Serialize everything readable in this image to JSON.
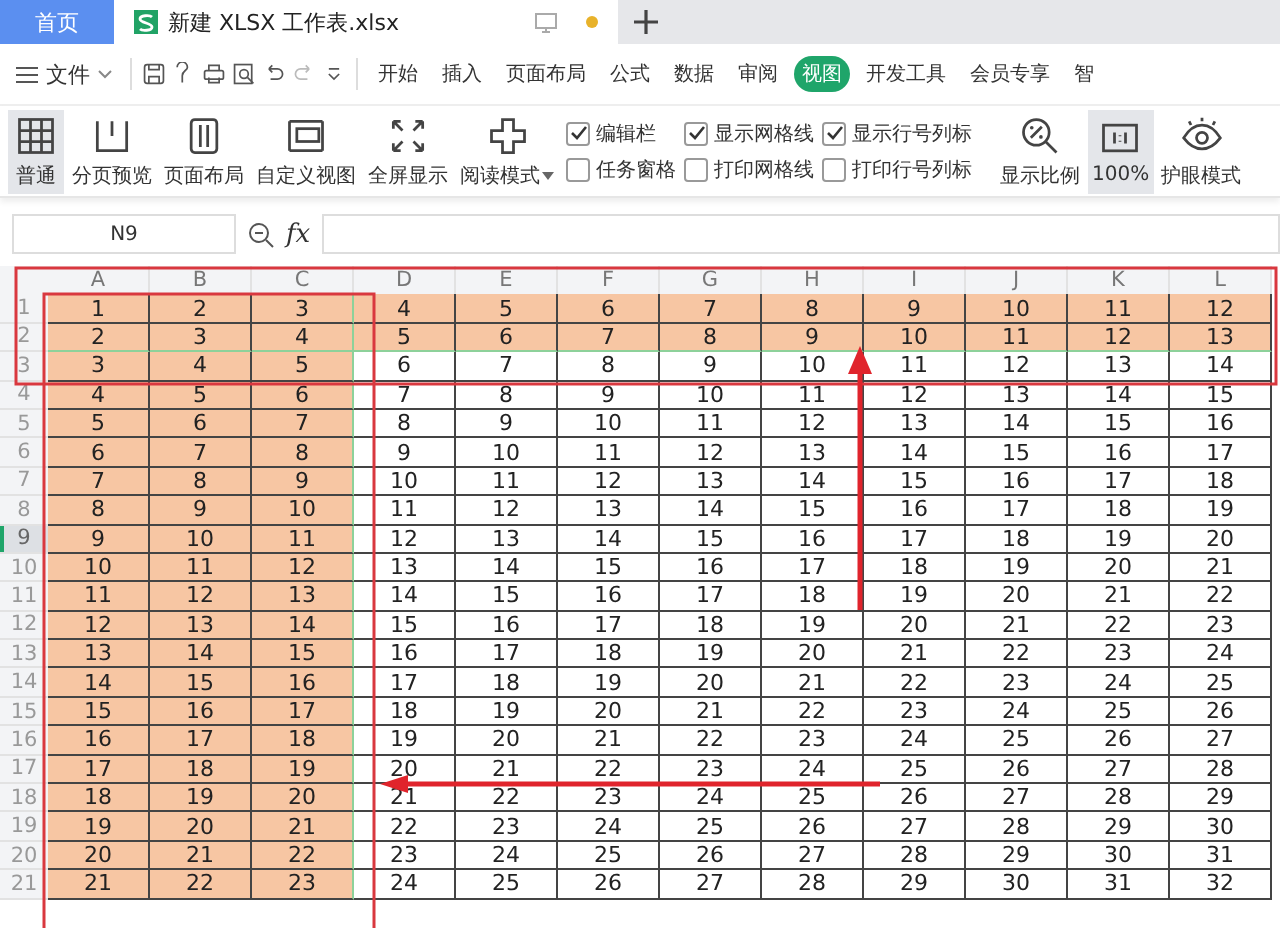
{
  "window_tabs": [
    {
      "label": "首页",
      "kind": "home",
      "selected": false
    },
    {
      "label": "新建 XLSX 工作表.xlsx",
      "kind": "doc",
      "selected": true
    }
  ],
  "quick_toolbar": {
    "file_menu": "文件"
  },
  "ribbon_tabs": [
    {
      "label": "开始",
      "selected": false
    },
    {
      "label": "插入",
      "selected": false
    },
    {
      "label": "页面布局",
      "selected": false
    },
    {
      "label": "公式",
      "selected": false
    },
    {
      "label": "数据",
      "selected": false
    },
    {
      "label": "审阅",
      "selected": false
    },
    {
      "label": "视图",
      "selected": true
    },
    {
      "label": "开发工具",
      "selected": false
    },
    {
      "label": "会员专享",
      "selected": false
    },
    {
      "label": "智",
      "selected": false
    }
  ],
  "view_buttons": [
    {
      "label": "普通",
      "selected": true
    },
    {
      "label": "分页预览",
      "selected": false
    },
    {
      "label": "页面布局",
      "selected": false
    },
    {
      "label": "自定义视图",
      "selected": false
    },
    {
      "label": "全屏显示",
      "selected": false
    },
    {
      "label": "阅读模式",
      "selected": false,
      "dropdown": true
    }
  ],
  "checkbox_columns": [
    [
      {
        "label": "编辑栏",
        "checked": true
      },
      {
        "label": "任务窗格",
        "checked": false
      }
    ],
    [
      {
        "label": "显示网格线",
        "checked": true
      },
      {
        "label": "打印网格线",
        "checked": false
      }
    ],
    [
      {
        "label": "显示行号列标",
        "checked": true
      },
      {
        "label": "打印行号列标",
        "checked": false
      }
    ]
  ],
  "zoom_buttons": [
    {
      "label": "显示比例",
      "selected": false
    },
    {
      "label": "100%",
      "selected": true
    },
    {
      "label": "护眼模式",
      "selected": false
    }
  ],
  "formula_bar": {
    "cell_ref": "N9",
    "fx": "fx"
  },
  "sheet": {
    "columns": [
      {
        "label": "A",
        "highlighted": true,
        "freeze_border": false
      },
      {
        "label": "B",
        "highlighted": true,
        "freeze_border": false
      },
      {
        "label": "C",
        "highlighted": true,
        "freeze_border": true
      },
      {
        "label": "D",
        "highlighted": false,
        "freeze_border": false
      },
      {
        "label": "E",
        "highlighted": false,
        "freeze_border": false
      },
      {
        "label": "F",
        "highlighted": false,
        "freeze_border": false
      },
      {
        "label": "G",
        "highlighted": false,
        "freeze_border": false
      },
      {
        "label": "H",
        "highlighted": false,
        "freeze_border": false
      },
      {
        "label": "I",
        "highlighted": false,
        "freeze_border": false
      },
      {
        "label": "J",
        "highlighted": false,
        "freeze_border": false
      },
      {
        "label": "K",
        "highlighted": false,
        "freeze_border": false
      },
      {
        "label": "L",
        "highlighted": false,
        "freeze_border": false
      }
    ],
    "rows": [
      {
        "number": "1",
        "highlighted": true,
        "frozen": false,
        "selected": false,
        "cells": [
          "1",
          "2",
          "3",
          "4",
          "5",
          "6",
          "7",
          "8",
          "9",
          "10",
          "11",
          "12"
        ]
      },
      {
        "number": "2",
        "highlighted": true,
        "frozen": true,
        "selected": false,
        "cells": [
          "2",
          "3",
          "4",
          "5",
          "6",
          "7",
          "8",
          "9",
          "10",
          "11",
          "12",
          "13"
        ]
      },
      {
        "number": "3",
        "highlighted": false,
        "frozen": false,
        "selected": false,
        "cells": [
          "3",
          "4",
          "5",
          "6",
          "7",
          "8",
          "9",
          "10",
          "11",
          "12",
          "13",
          "14"
        ]
      },
      {
        "number": "4",
        "highlighted": false,
        "frozen": false,
        "selected": false,
        "cells": [
          "4",
          "5",
          "6",
          "7",
          "8",
          "9",
          "10",
          "11",
          "12",
          "13",
          "14",
          "15"
        ]
      },
      {
        "number": "5",
        "highlighted": false,
        "frozen": false,
        "selected": false,
        "cells": [
          "5",
          "6",
          "7",
          "8",
          "9",
          "10",
          "11",
          "12",
          "13",
          "14",
          "15",
          "16"
        ]
      },
      {
        "number": "6",
        "highlighted": false,
        "frozen": false,
        "selected": false,
        "cells": [
          "6",
          "7",
          "8",
          "9",
          "10",
          "11",
          "12",
          "13",
          "14",
          "15",
          "16",
          "17"
        ]
      },
      {
        "number": "7",
        "highlighted": false,
        "frozen": false,
        "selected": false,
        "cells": [
          "7",
          "8",
          "9",
          "10",
          "11",
          "12",
          "13",
          "14",
          "15",
          "16",
          "17",
          "18"
        ]
      },
      {
        "number": "8",
        "highlighted": false,
        "frozen": false,
        "selected": false,
        "cells": [
          "8",
          "9",
          "10",
          "11",
          "12",
          "13",
          "14",
          "15",
          "16",
          "17",
          "18",
          "19"
        ]
      },
      {
        "number": "9",
        "highlighted": false,
        "frozen": false,
        "selected": true,
        "cells": [
          "9",
          "10",
          "11",
          "12",
          "13",
          "14",
          "15",
          "16",
          "17",
          "18",
          "19",
          "20"
        ]
      },
      {
        "number": "10",
        "highlighted": false,
        "frozen": false,
        "selected": false,
        "cells": [
          "10",
          "11",
          "12",
          "13",
          "14",
          "15",
          "16",
          "17",
          "18",
          "19",
          "20",
          "21"
        ]
      },
      {
        "number": "11",
        "highlighted": false,
        "frozen": false,
        "selected": false,
        "cells": [
          "11",
          "12",
          "13",
          "14",
          "15",
          "16",
          "17",
          "18",
          "19",
          "20",
          "21",
          "22"
        ]
      },
      {
        "number": "12",
        "highlighted": false,
        "frozen": false,
        "selected": false,
        "cells": [
          "12",
          "13",
          "14",
          "15",
          "16",
          "17",
          "18",
          "19",
          "20",
          "21",
          "22",
          "23"
        ]
      },
      {
        "number": "13",
        "highlighted": false,
        "frozen": false,
        "selected": false,
        "cells": [
          "13",
          "14",
          "15",
          "16",
          "17",
          "18",
          "19",
          "20",
          "21",
          "22",
          "23",
          "24"
        ]
      },
      {
        "number": "14",
        "highlighted": false,
        "frozen": false,
        "selected": false,
        "cells": [
          "14",
          "15",
          "16",
          "17",
          "18",
          "19",
          "20",
          "21",
          "22",
          "23",
          "24",
          "25"
        ]
      },
      {
        "number": "15",
        "highlighted": false,
        "frozen": false,
        "selected": false,
        "cells": [
          "15",
          "16",
          "17",
          "18",
          "19",
          "20",
          "21",
          "22",
          "23",
          "24",
          "25",
          "26"
        ]
      },
      {
        "number": "16",
        "highlighted": false,
        "frozen": false,
        "selected": false,
        "cells": [
          "16",
          "17",
          "18",
          "19",
          "20",
          "21",
          "22",
          "23",
          "24",
          "25",
          "26",
          "27"
        ]
      },
      {
        "number": "17",
        "highlighted": false,
        "frozen": false,
        "selected": false,
        "cells": [
          "17",
          "18",
          "19",
          "20",
          "21",
          "22",
          "23",
          "24",
          "25",
          "26",
          "27",
          "28"
        ]
      },
      {
        "number": "18",
        "highlighted": false,
        "frozen": false,
        "selected": false,
        "cells": [
          "18",
          "19",
          "20",
          "21",
          "22",
          "23",
          "24",
          "25",
          "26",
          "27",
          "28",
          "29"
        ]
      },
      {
        "number": "19",
        "highlighted": false,
        "frozen": false,
        "selected": false,
        "cells": [
          "19",
          "20",
          "21",
          "22",
          "23",
          "24",
          "25",
          "26",
          "27",
          "28",
          "29",
          "30"
        ]
      },
      {
        "number": "20",
        "highlighted": false,
        "frozen": false,
        "selected": false,
        "cells": [
          "20",
          "21",
          "22",
          "23",
          "24",
          "25",
          "26",
          "27",
          "28",
          "29",
          "30",
          "31"
        ]
      },
      {
        "number": "21",
        "highlighted": false,
        "frozen": false,
        "selected": false,
        "cells": [
          "21",
          "22",
          "23",
          "24",
          "25",
          "26",
          "27",
          "28",
          "29",
          "30",
          "31",
          "32"
        ]
      }
    ]
  }
}
